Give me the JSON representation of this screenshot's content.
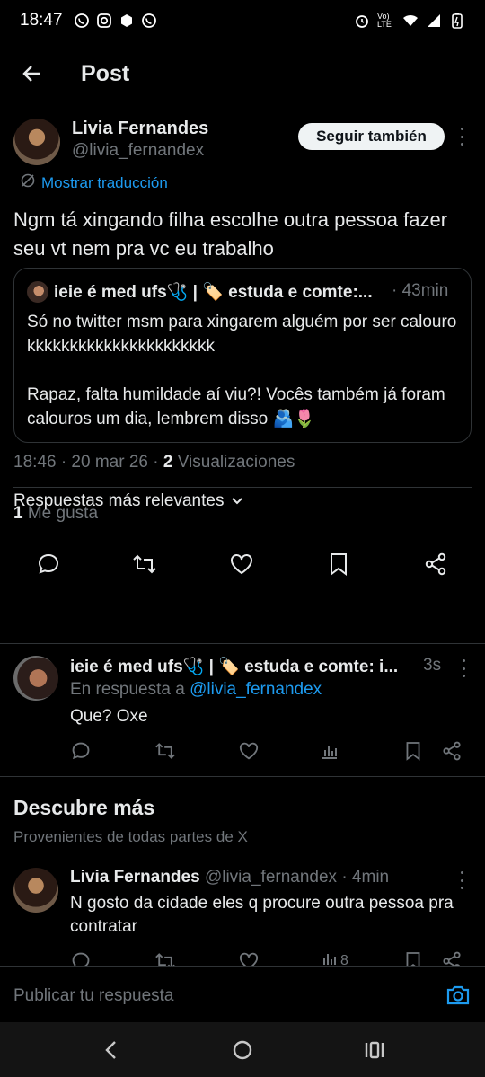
{
  "status_bar": {
    "time": "18:47",
    "network": "Vo) LTE"
  },
  "header": {
    "title": "Post"
  },
  "post": {
    "author_name": "Livia Fernandes",
    "author_handle": "@livia_fernandex",
    "follow_label": "Seguir también",
    "translate_label": "Mostrar traducción",
    "text": "Ngm tá xingando filha escolhe outra pessoa fazer seu vt nem pra vc eu trabalho",
    "quote": {
      "author": "ieie é med ufs🩺 | 🏷️ estuda e comte:...",
      "time": "· 43min",
      "text": "Só no twitter msm para xingarem alguém por ser calouro kkkkkkkkkkkkkkkkkkkkkk\n\nRapaz, falta humildade aí viu?! Vocês também já foram calouros um dia, lembrem disso 🫂🌷"
    },
    "meta_datetime": "18:46 · 20 mar 26 · ",
    "meta_views_count": "2",
    "meta_views_label": " Visualizaciones",
    "likes_count": "1",
    "likes_label": " Me gusta"
  },
  "replies_sort": "Respuestas más relevantes",
  "reply": {
    "author": "ieie é med ufs🩺 | 🏷️ estuda e comte: i...",
    "time": "3s",
    "in_reply_prefix": "En respuesta a ",
    "in_reply_handle": "@livia_fernandex",
    "text": "Que? Oxe"
  },
  "discover": {
    "title": "Descubre más",
    "subtitle": "Provenientes de todas partes de X"
  },
  "discover_post": {
    "author_name": "Livia Fernandes",
    "handle_time": " @livia_fernandex · 4min",
    "text": "N gosto da cidade eles q procure outra pessoa pra contratar",
    "views": "8"
  },
  "composer": {
    "placeholder": "Publicar tu respuesta"
  },
  "colors": {
    "accent": "#1d9bf0",
    "muted": "#71767b",
    "text": "#e7e9ea",
    "bg": "#000000"
  }
}
